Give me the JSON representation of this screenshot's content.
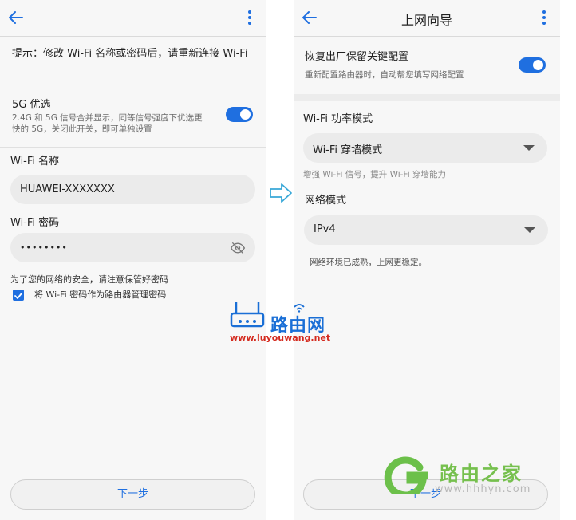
{
  "left": {
    "hint": "提示：修改 Wi-Fi 名称或密码后，请重新连接 Wi-Fi",
    "pref5g": {
      "title": "5G 优选",
      "desc": "2.4G 和 5G 信号合并显示，同等信号强度下优选更快的 5G，关闭此开关，即可单独设置",
      "enabled": true
    },
    "wifi_name_label": "Wi-Fi 名称",
    "wifi_name_value": "HUAWEI-XXXXXXX",
    "wifi_pwd_label": "Wi-Fi 密码",
    "wifi_pwd_value": "••••••••",
    "security_note": "为了您的网络的安全，请注意保管好密码",
    "checkbox_label": "将 Wi-Fi 密码作为路由器管理密码",
    "checkbox_checked": true,
    "next_label": "下一步"
  },
  "right": {
    "title": "上网向导",
    "reset": {
      "title": "恢复出厂保留关键配置",
      "desc": "重新配置路由器时，自动帮您填写网络配置",
      "enabled": true
    },
    "power_label": "Wi-Fi 功率模式",
    "power_value": "Wi-Fi 穿墙模式",
    "power_desc": "增强 Wi-Fi 信号，提升 Wi-Fi 穿墙能力",
    "net_label": "网络模式",
    "net_value": "IPv4",
    "net_desc": "网络环境已成熟，上网更稳定。",
    "next_label": "下一步"
  },
  "watermark": {
    "logo_text": "路由网",
    "url": "www.luyouwang.net",
    "brand2": "路由之家",
    "brand2_url": "www.hhhyn.com"
  },
  "colors": {
    "accent": "#1f6fe0",
    "bg": "#f7f7f7",
    "field": "#ebebeb"
  }
}
